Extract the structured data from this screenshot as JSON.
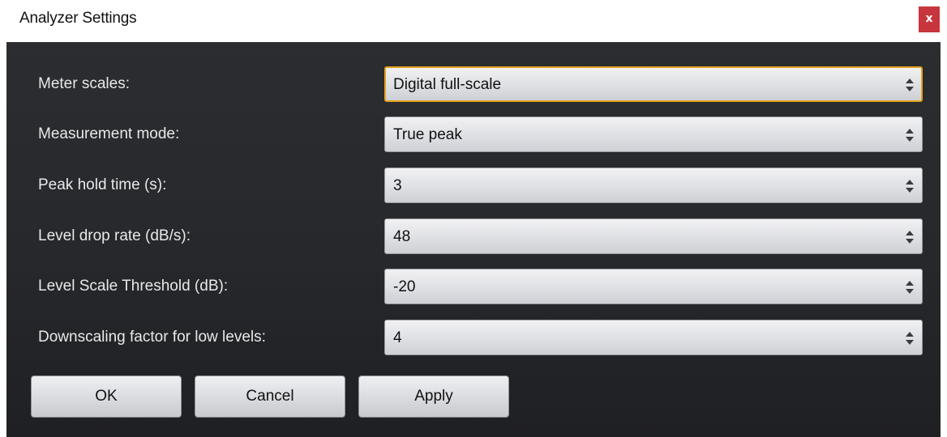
{
  "window": {
    "title": "Analyzer Settings",
    "close_label": "x"
  },
  "settings": [
    {
      "label": "Meter scales:",
      "value": "Digital full-scale",
      "focused": true
    },
    {
      "label": "Measurement mode:",
      "value": "True peak",
      "focused": false
    },
    {
      "label": "Peak hold time (s):",
      "value": "3",
      "focused": false
    },
    {
      "label": "Level drop rate (dB/s):",
      "value": "48",
      "focused": false
    },
    {
      "label": "Level Scale Threshold (dB):",
      "value": "-20",
      "focused": false
    },
    {
      "label": "Downscaling factor for low levels:",
      "value": "4",
      "focused": false
    }
  ],
  "buttons": {
    "ok": "OK",
    "cancel": "Cancel",
    "apply": "Apply"
  },
  "icons": {
    "close": "close-icon",
    "select_arrows": "up-down-arrows-icon"
  },
  "colors": {
    "focus_border": "#e5a21e",
    "close_button": "#c8363d",
    "panel_background": "#26282c"
  }
}
